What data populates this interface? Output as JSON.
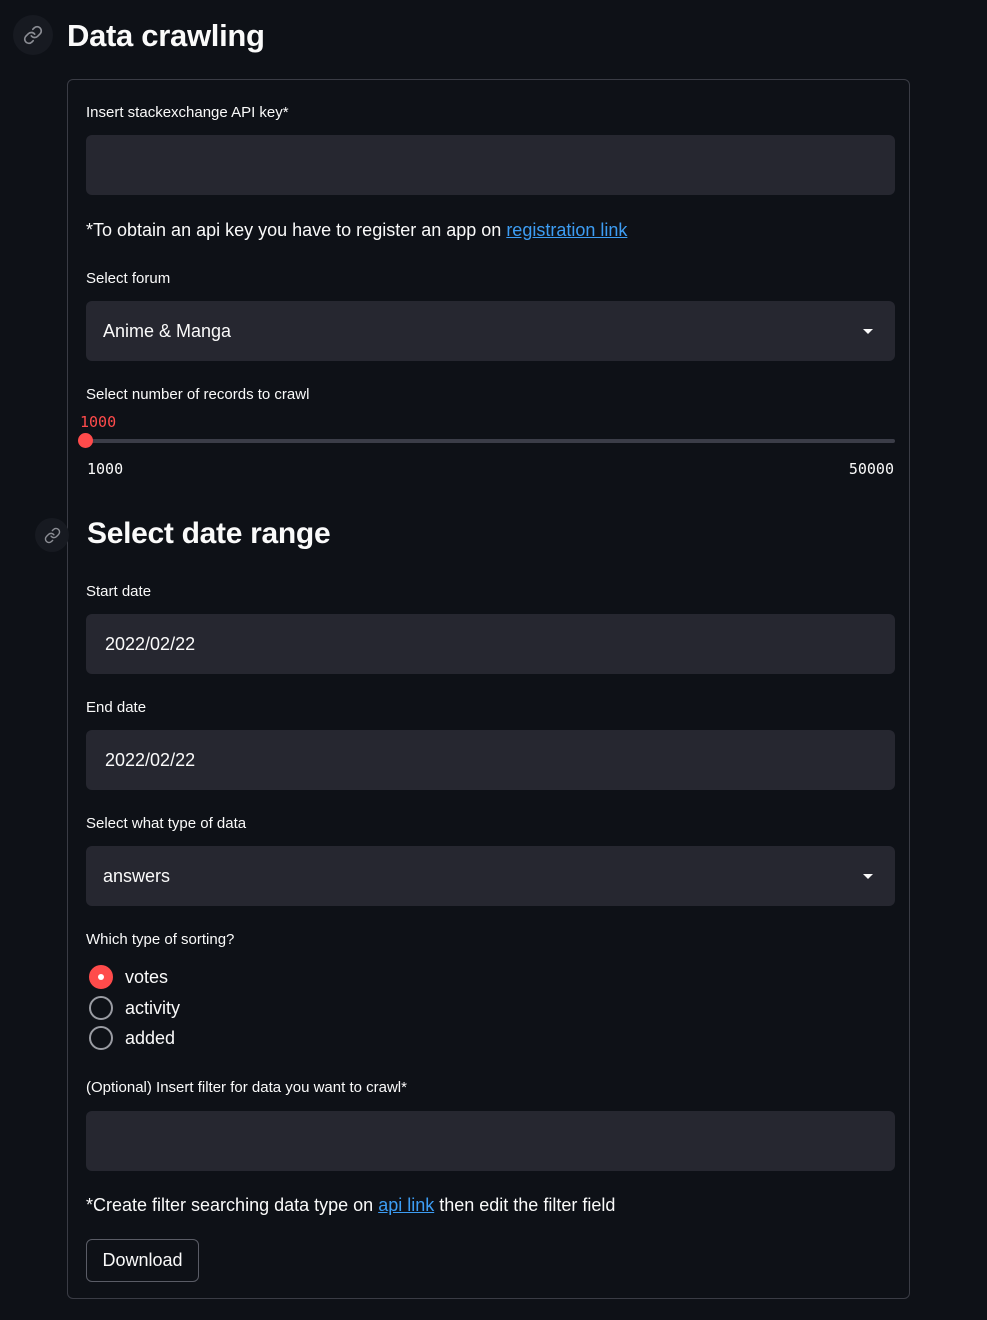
{
  "header": {
    "title": "Data crawling",
    "anchor_icon": "link-icon"
  },
  "form": {
    "api_key": {
      "label": "Insert stackexchange API key*",
      "value": "",
      "help_prefix": "*To obtain an api key you have to register an app on",
      "help_link": "registration link"
    },
    "forum": {
      "label": "Select forum",
      "selected": "Anime & Manga",
      "icon": "chevron-down-icon"
    },
    "records": {
      "label": "Select number of records to crawl",
      "value": "1000",
      "min": "1000",
      "max": "50000"
    },
    "date_section": {
      "title": "Select date range",
      "anchor_icon": "link-icon"
    },
    "start_date": {
      "label": "Start date",
      "value": "2022/02/22"
    },
    "end_date": {
      "label": "End date",
      "value": "2022/02/22"
    },
    "data_type": {
      "label": "Select what type of data",
      "selected": "answers",
      "icon": "chevron-down-icon"
    },
    "sorting": {
      "label": "Which type of sorting?",
      "options": [
        "votes",
        "activity",
        "added"
      ],
      "selected": "votes"
    },
    "filter": {
      "label": "(Optional) Insert filter for data you want to crawl*",
      "value": "",
      "help_prefix": "*Create filter searching data type on",
      "help_link": "api link",
      "help_suffix": "then edit the filter field"
    },
    "download_label": "Download"
  },
  "colors": {
    "background": "#0e1117",
    "input_bg": "#262730",
    "accent": "#ff4b4b",
    "link": "#3d9df3"
  }
}
